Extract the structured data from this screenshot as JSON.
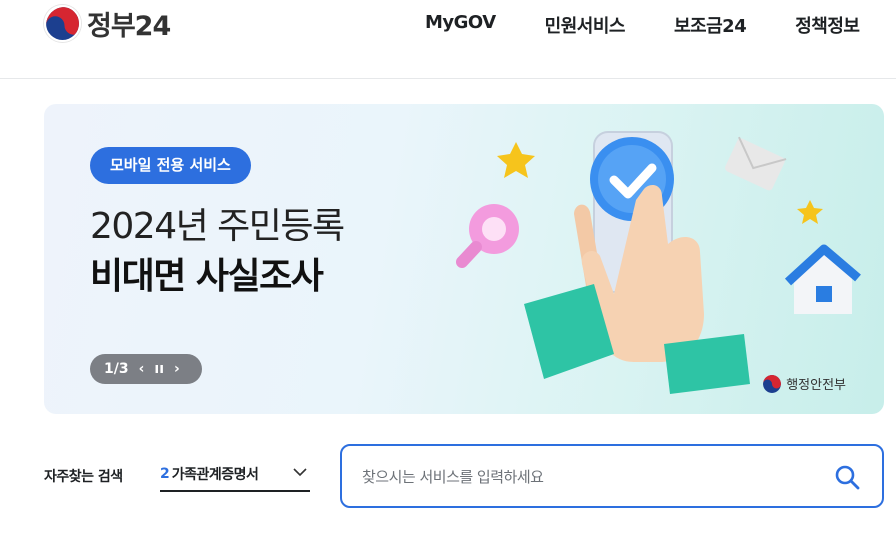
{
  "header": {
    "logo_text": "정부24",
    "nav": [
      "MyGOV",
      "민원서비스",
      "보조금24",
      "정책정보"
    ]
  },
  "banner": {
    "tag": "모바일 전용 서비스",
    "title_line1": "2024년 주민등록",
    "title_line2": "비대면 사실조사",
    "pager": "1/3",
    "prev_icon": "‹",
    "pause_icon": "ıı",
    "next_icon": "›",
    "ministry": "행정안전부"
  },
  "search": {
    "frequent_label": "자주찾는 검색",
    "frequent_rank": "2",
    "frequent_value": "가족관계증명서",
    "placeholder": "찾으시는 서비스를 입력하세요"
  },
  "colors": {
    "accent": "#2d6fdf",
    "pager_bg": "#7c7f85"
  }
}
